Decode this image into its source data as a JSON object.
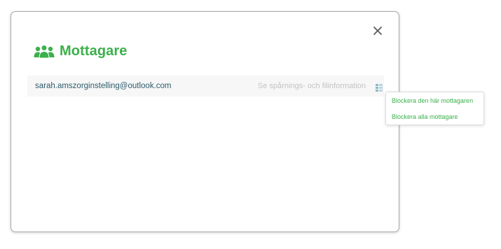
{
  "colors": {
    "accent": "#3bb04b",
    "close_icon": "#5a5a5a",
    "email_text": "#2d5c6b",
    "muted_text": "#c3c3c3",
    "menu_icon": "#8cb8c9"
  },
  "icons": {
    "header": "people-icon",
    "close": "close-icon",
    "row_menu": "menu-icon"
  },
  "dialog": {
    "title": "Mottagare",
    "recipient": {
      "email": "sarah.amszorginstelling@outlook.com",
      "tracking_link": "Se spårnings- och filinformation"
    }
  },
  "dropdown": {
    "items": [
      {
        "label": "Blockera den här mottagaren"
      },
      {
        "label": "Blockera alla mottagare"
      }
    ]
  }
}
